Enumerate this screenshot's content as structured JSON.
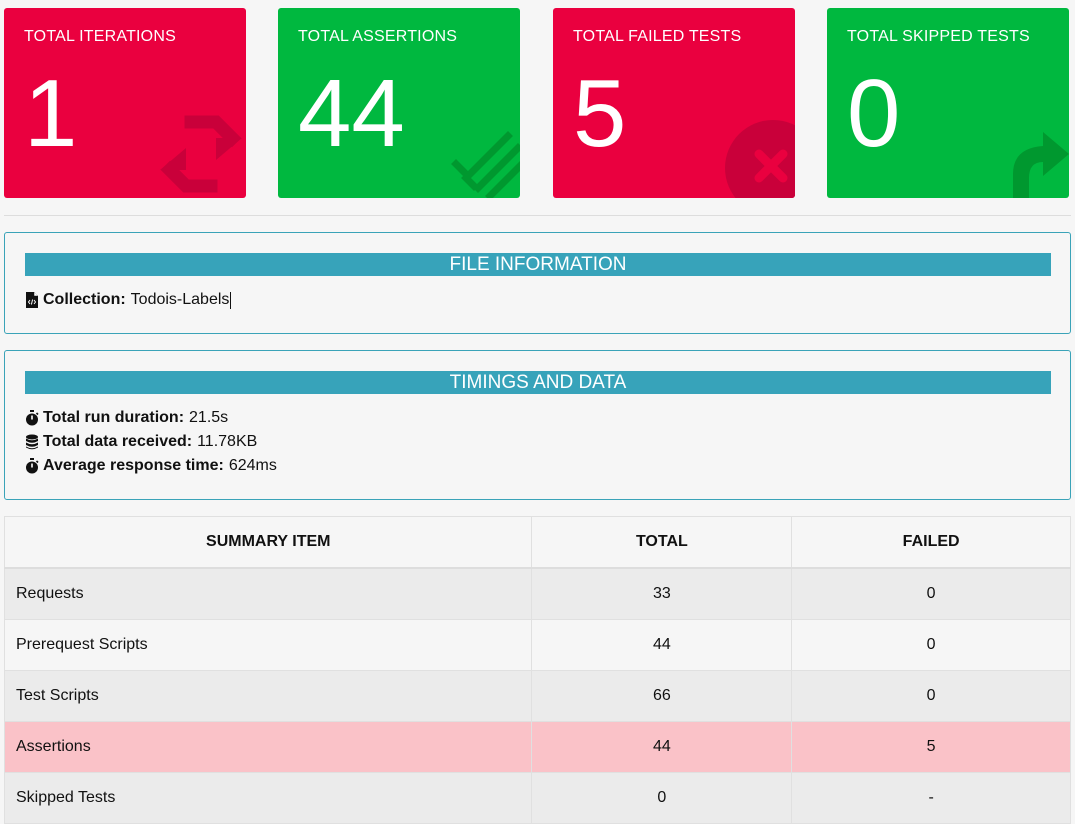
{
  "cards": [
    {
      "title": "TOTAL ITERATIONS",
      "value": "1",
      "color": "#ea003f",
      "icon": "refresh-icon"
    },
    {
      "title": "TOTAL ASSERTIONS",
      "value": "44",
      "color": "#00b83f",
      "icon": "check-list-icon"
    },
    {
      "title": "TOTAL FAILED TESTS",
      "value": "5",
      "color": "#ea003f",
      "icon": "times-circle-icon"
    },
    {
      "title": "TOTAL SKIPPED TESTS",
      "value": "0",
      "color": "#00b83f",
      "icon": "share-arrow-icon"
    }
  ],
  "file_info": {
    "title": "FILE INFORMATION",
    "collection_label": "Collection:",
    "collection_value": "Todois-Labels"
  },
  "timings": {
    "title": "TIMINGS AND DATA",
    "run_duration_label": "Total run duration:",
    "run_duration_value": "21.5s",
    "data_received_label": "Total data received:",
    "data_received_value": "11.78KB",
    "avg_response_label": "Average response time:",
    "avg_response_value": "624ms"
  },
  "summary": {
    "headers": [
      "SUMMARY ITEM",
      "TOTAL",
      "FAILED"
    ],
    "rows": [
      {
        "item": "Requests",
        "total": "33",
        "failed": "0"
      },
      {
        "item": "Prerequest Scripts",
        "total": "44",
        "failed": "0"
      },
      {
        "item": "Test Scripts",
        "total": "66",
        "failed": "0"
      },
      {
        "item": "Assertions",
        "total": "44",
        "failed": "5"
      },
      {
        "item": "Skipped Tests",
        "total": "0",
        "failed": "-"
      }
    ]
  },
  "colors": {
    "accent": "#37a3ba",
    "danger": "#ea003f",
    "success": "#00b83f",
    "danger_row": "#fac2c8"
  }
}
